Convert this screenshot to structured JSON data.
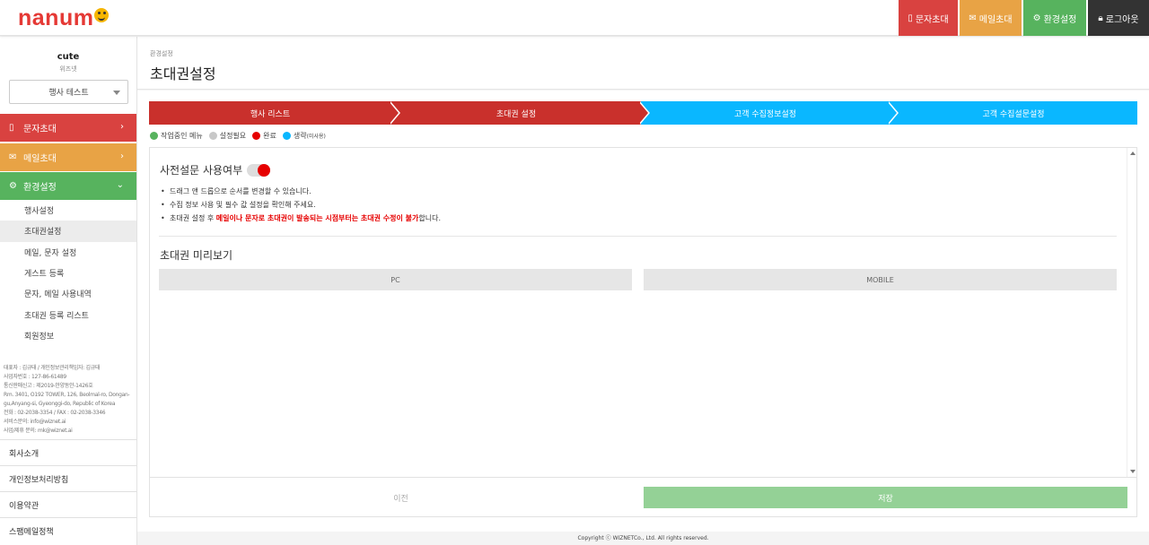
{
  "app": {
    "logo_text": "nanum",
    "logo_icon": "smiley-face-icon"
  },
  "topnav": {
    "sms": {
      "label": "문자초대",
      "icon": "phone-icon",
      "color": "#d94240"
    },
    "mail": {
      "label": "메일초대",
      "icon": "envelope-icon",
      "color": "#e8a345"
    },
    "env": {
      "label": "환경설정",
      "icon": "gear-icon",
      "color": "#57b35e"
    },
    "logout": {
      "label": "로그아웃",
      "icon": "lock-icon",
      "color": "#333333"
    }
  },
  "sidebar": {
    "profile_name": "cute",
    "profile_sub": "위즈넷",
    "event_select": "행사 테스트",
    "menu": [
      {
        "label": "문자초대",
        "icon": "phone-icon",
        "color": "#d94240"
      },
      {
        "label": "메일초대",
        "icon": "envelope-icon",
        "color": "#e8a345"
      },
      {
        "label": "환경설정",
        "icon": "gear-icon",
        "color": "#57b35e"
      }
    ],
    "submenu": [
      "행사설정",
      "초대권설정",
      "메일, 문자 설정",
      "게스트 등록",
      "문자, 메일 사용내역",
      "초대권 등록 리스트",
      "회원정보"
    ],
    "active_submenu": "초대권설정",
    "company_info": [
      "대표자 : 김규태 / 개인정보관리책임자: 김규태",
      "사업자번호 : 127-86-61489",
      "통신판매신고 : 제2019-안양동안-1426호",
      "Rm. 3401, O192 TOWER, 126, Beolmal-ro, Dongan-gu,Anyang-si, Gyeonggi-do, Republic of Korea",
      "전화 : 02-2038-3354 / FAX : 02-2038-3346",
      "서비스문의: info@wiznet.ai",
      "사업/제휴 문의: mk@wiznet.ai"
    ],
    "footer_links": [
      "회사소개",
      "개인정보처리방침",
      "이용약관",
      "스팸메일정책"
    ]
  },
  "page": {
    "breadcrumb": "환경설정",
    "title": "초대권설정"
  },
  "steps": [
    {
      "label": "행사 리스트",
      "status": "done"
    },
    {
      "label": "초대권 설정",
      "status": "done"
    },
    {
      "label": "고객 수집정보설정",
      "status": "skip"
    },
    {
      "label": "고객 수집설문설정",
      "status": "skip"
    }
  ],
  "legend": {
    "working": {
      "label": "작업중인 메뉴",
      "color": "#57b35e"
    },
    "required": {
      "label": "설정필요",
      "color": "#c8c8c8"
    },
    "done": {
      "label": "완료",
      "color": "#e60000"
    },
    "skip": {
      "label": "생략",
      "sub": "(미사용)",
      "color": "#0ab7ff"
    }
  },
  "survey": {
    "title": "사전설문 사용여부",
    "toggle_on": true,
    "notes": [
      "드래그 앤 드롭으로 순서를 변경할 수 있습니다.",
      "수집 정보 사용 및 필수 값 설정을 확인해 주세요."
    ],
    "note3_prefix": "초대권 설정 후 ",
    "note3_highlight": "메일이나 문자로 초대권이 발송되는 시점부터는 초대권 수정이 불가",
    "note3_suffix": "합니다."
  },
  "preview": {
    "title": "초대권 미리보기",
    "pc_label": "PC",
    "mobile_label": "MOBILE"
  },
  "actions": {
    "prev_label": "이전",
    "save_label": "저장"
  },
  "copyright": "Copyright ⓒ WIZNETCo., Ltd. All rights reserved."
}
